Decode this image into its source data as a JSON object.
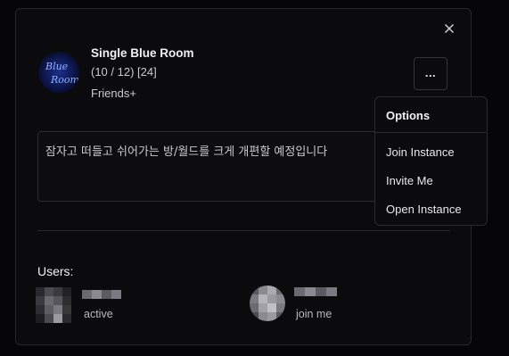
{
  "room": {
    "name": "Single Blue Room",
    "count": "(10 / 12) [24]",
    "access": "Friends+",
    "thumbnail_text_line1": "Blue",
    "thumbnail_text_line2": "Room",
    "description": "잠자고 떠들고 쉬어가는 방/월드를 크게 개편할 예정입니다"
  },
  "actions": {
    "more_label": "...",
    "close_icon": "close-icon"
  },
  "options_menu": {
    "title": "Options",
    "items": [
      {
        "label": "Join Instance"
      },
      {
        "label": "Invite Me"
      },
      {
        "label": "Open Instance"
      }
    ]
  },
  "users": {
    "heading": "Users:",
    "list": [
      {
        "status": "active"
      },
      {
        "status": "join me"
      }
    ]
  },
  "colors": {
    "background": "#060608",
    "panel": "#0b0b0e",
    "border": "#26262c",
    "text_primary": "#f1f1f3",
    "text_secondary": "#c9c9ce"
  }
}
